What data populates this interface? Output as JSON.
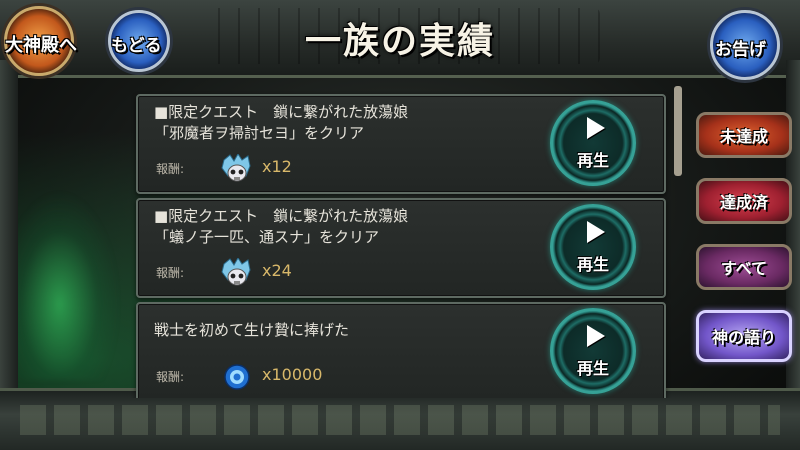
{
  "header": {
    "title": "一族の実績",
    "temple_button_label": "大神殿へ",
    "back_button_label": "もどる",
    "notice_button_label": "お告げ"
  },
  "achievements": [
    {
      "line1": "■限定クエスト　鎖に繋がれた放蕩娘",
      "line2": "「邪魔者ヲ掃討セヨ」をクリア",
      "reward_label": "報酬:",
      "reward_icon": "skull-crystal-icon",
      "reward_qty": "x12",
      "play_label": "再生"
    },
    {
      "line1": "■限定クエスト　鎖に繋がれた放蕩娘",
      "line2": "「蟻ノ子一匹、通スナ」をクリア",
      "reward_label": "報酬:",
      "reward_icon": "skull-crystal-icon",
      "reward_qty": "x24",
      "play_label": "再生"
    },
    {
      "line1": "戦士を初めて生け贄に捧げた",
      "line2": "",
      "reward_label": "報酬:",
      "reward_icon": "blue-orb-icon",
      "reward_qty": "x10000",
      "play_label": "再生"
    }
  ],
  "filters": [
    {
      "label": "未達成"
    },
    {
      "label": "達成済"
    },
    {
      "label": "すべて"
    },
    {
      "label": "神の語り"
    }
  ],
  "colors": {
    "accent_teal": "#36a196",
    "reward_gold": "#d8b86a"
  }
}
